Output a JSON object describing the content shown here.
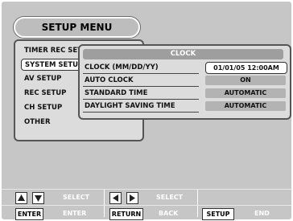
{
  "setup_menu": {
    "title": "SETUP MENU",
    "items": [
      {
        "label": "TIMER REC SET"
      },
      {
        "label": "SYSTEM SETUP"
      },
      {
        "label": "AV SETUP"
      },
      {
        "label": "REC SETUP"
      },
      {
        "label": "CH SETUP"
      },
      {
        "label": "OTHER"
      }
    ]
  },
  "clock": {
    "title": "CLOCK",
    "rows": [
      {
        "label": "CLOCK (MM/DD/YY)",
        "value": "01/01/05 12:00AM"
      },
      {
        "label": "AUTO CLOCK",
        "value": "ON"
      },
      {
        "label": "STANDARD TIME",
        "value": "AUTOMATIC"
      },
      {
        "label": "DAYLIGHT SAVING TIME",
        "value": "AUTOMATIC"
      }
    ]
  },
  "nav": {
    "up_down_label": "SELECT",
    "left_right_label": "SELECT",
    "enter_key": "ENTER",
    "enter_label": "ENTER",
    "return_key": "RETURN",
    "return_label": "BACK",
    "setup_key": "SETUP",
    "setup_label": "END"
  },
  "colors": {
    "background": "#c6c6c6",
    "panel": "#dcdcdc",
    "value_box": "#b3b3b3",
    "header_bar": "#9e9e9e"
  }
}
